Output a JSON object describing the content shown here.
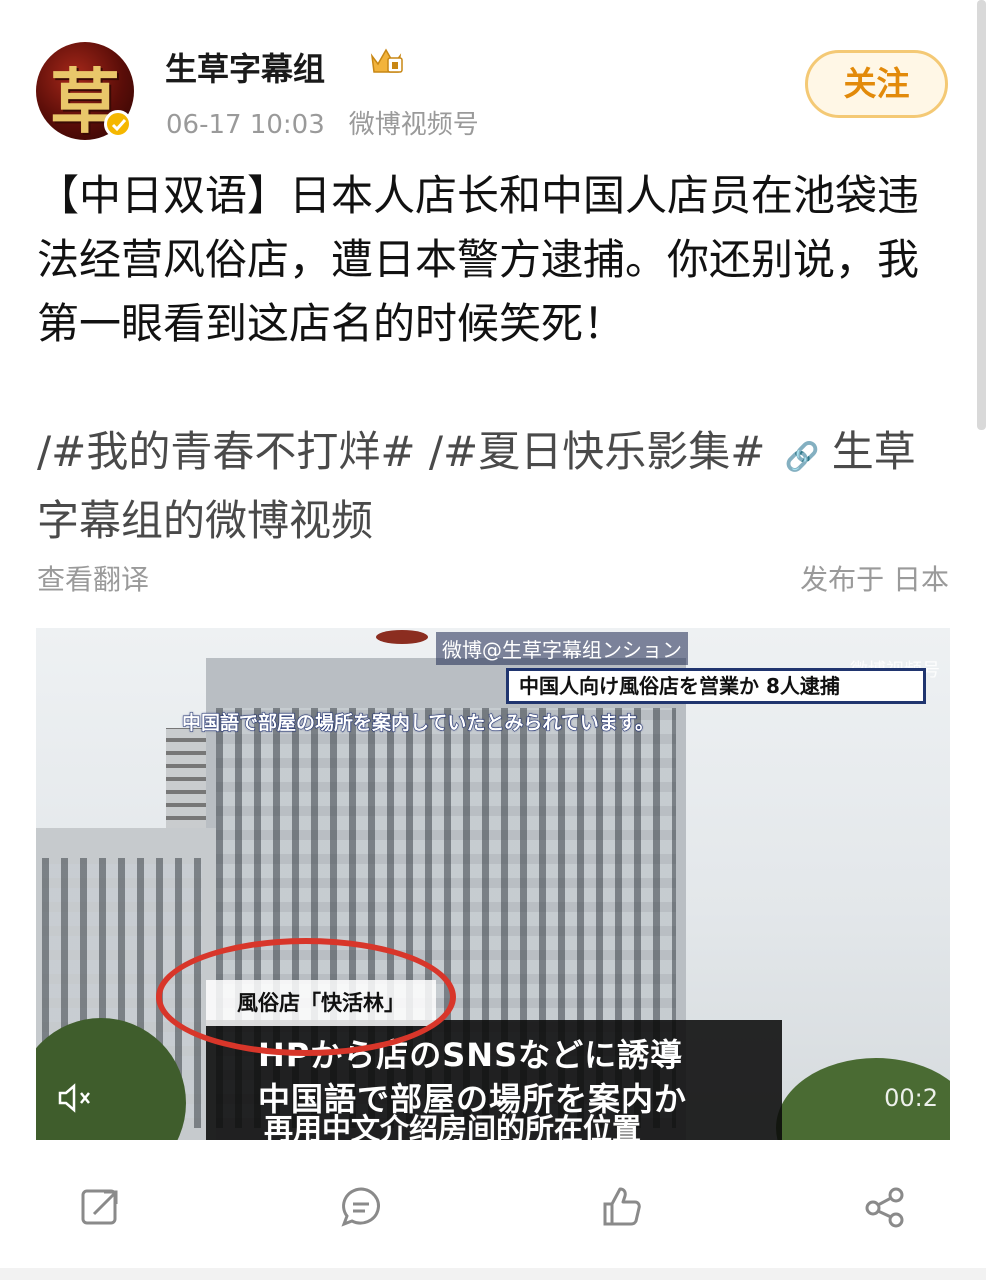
{
  "post": {
    "username": "生草字幕组",
    "badge_icon": "crown-vip-icon",
    "time": "06-17 10:03",
    "source": "微博视频号",
    "follow_label": "关注",
    "text": "【中日双语】日本人店长和中国人店员在池袋违法经营风俗店，遭日本警方逮捕。你还别说，我第一眼看到这店名的时候笑死！",
    "tags": [
      "/#我的青春不打烊#",
      "/#夏日快乐影集#"
    ],
    "link_text": "生草字幕组的微博视频",
    "translate_label": "查看翻译",
    "location": "发布于 日本",
    "avatar_char": "草"
  },
  "video": {
    "top_label": "微博@生草字幕组ンション",
    "watermark": "微博视频号",
    "news_title": "中国人向け風俗店を営業か 8人逮捕",
    "subtitle_top": "中国語で部屋の場所を案内していたとみられています。",
    "store_label": "風俗店「快活林」",
    "caption_line1": "HPから店のSNSなどに誘導",
    "caption_line2": "中国語で部屋の場所を案内か",
    "caption_cn": "再用中文介绍房间的所在位置",
    "time": "00:2"
  },
  "actions": {
    "repost_icon": "repost-icon",
    "comment_icon": "comment-icon",
    "like_icon": "like-icon",
    "share_icon": "share-icon"
  },
  "colors": {
    "follow_text": "#e28a0a",
    "follow_border": "#f4c975",
    "circle_red": "#d8362a"
  }
}
